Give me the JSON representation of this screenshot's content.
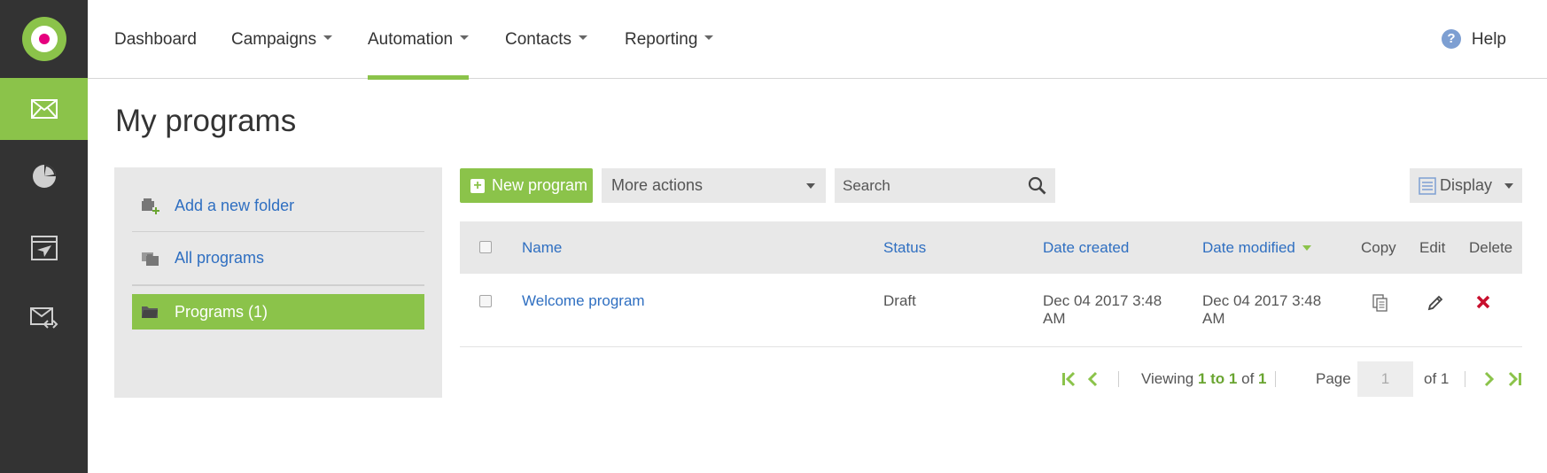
{
  "nav": {
    "items": [
      {
        "label": "Dashboard"
      },
      {
        "label": "Campaigns"
      },
      {
        "label": "Automation"
      },
      {
        "label": "Contacts"
      },
      {
        "label": "Reporting"
      }
    ],
    "active": "Automation",
    "help_label": "Help"
  },
  "rail": {
    "items": [
      "envelope-icon",
      "pie-chart-icon",
      "browser-send-icon",
      "email-code-icon"
    ],
    "active": "envelope-icon"
  },
  "page": {
    "title": "My programs"
  },
  "folders": {
    "items": [
      {
        "label": "Add a new folder",
        "icon": "add-folder-icon"
      },
      {
        "label": "All programs",
        "icon": "folders-icon"
      },
      {
        "label": "Programs (1)",
        "icon": "folder-icon"
      }
    ],
    "selected": "Programs (1)"
  },
  "toolbar": {
    "new_program_label": "New program",
    "more_actions_label": "More actions",
    "search_placeholder": "Search",
    "display_label": "Display"
  },
  "table": {
    "columns": {
      "name": "Name",
      "status": "Status",
      "date_created": "Date created",
      "date_modified": "Date modified",
      "copy": "Copy",
      "edit": "Edit",
      "delete": "Delete"
    },
    "sort_column": "Date modified",
    "rows": [
      {
        "name": "Welcome program",
        "status": "Draft",
        "date_created": "Dec 04 2017 3:48 AM",
        "date_modified": "Dec 04 2017 3:48 AM"
      }
    ]
  },
  "pagination": {
    "viewing_prefix": "Viewing",
    "range": "1 to 1",
    "of_label": "of",
    "total": "1",
    "page_label": "Page",
    "page_value": "1",
    "page_of": "of 1"
  },
  "colors": {
    "accent_green": "#8bc34a",
    "rail_bg": "#333333",
    "link_blue": "#2f6fc1",
    "delete_red": "#c8102e",
    "logo_magenta": "#e6007e"
  }
}
